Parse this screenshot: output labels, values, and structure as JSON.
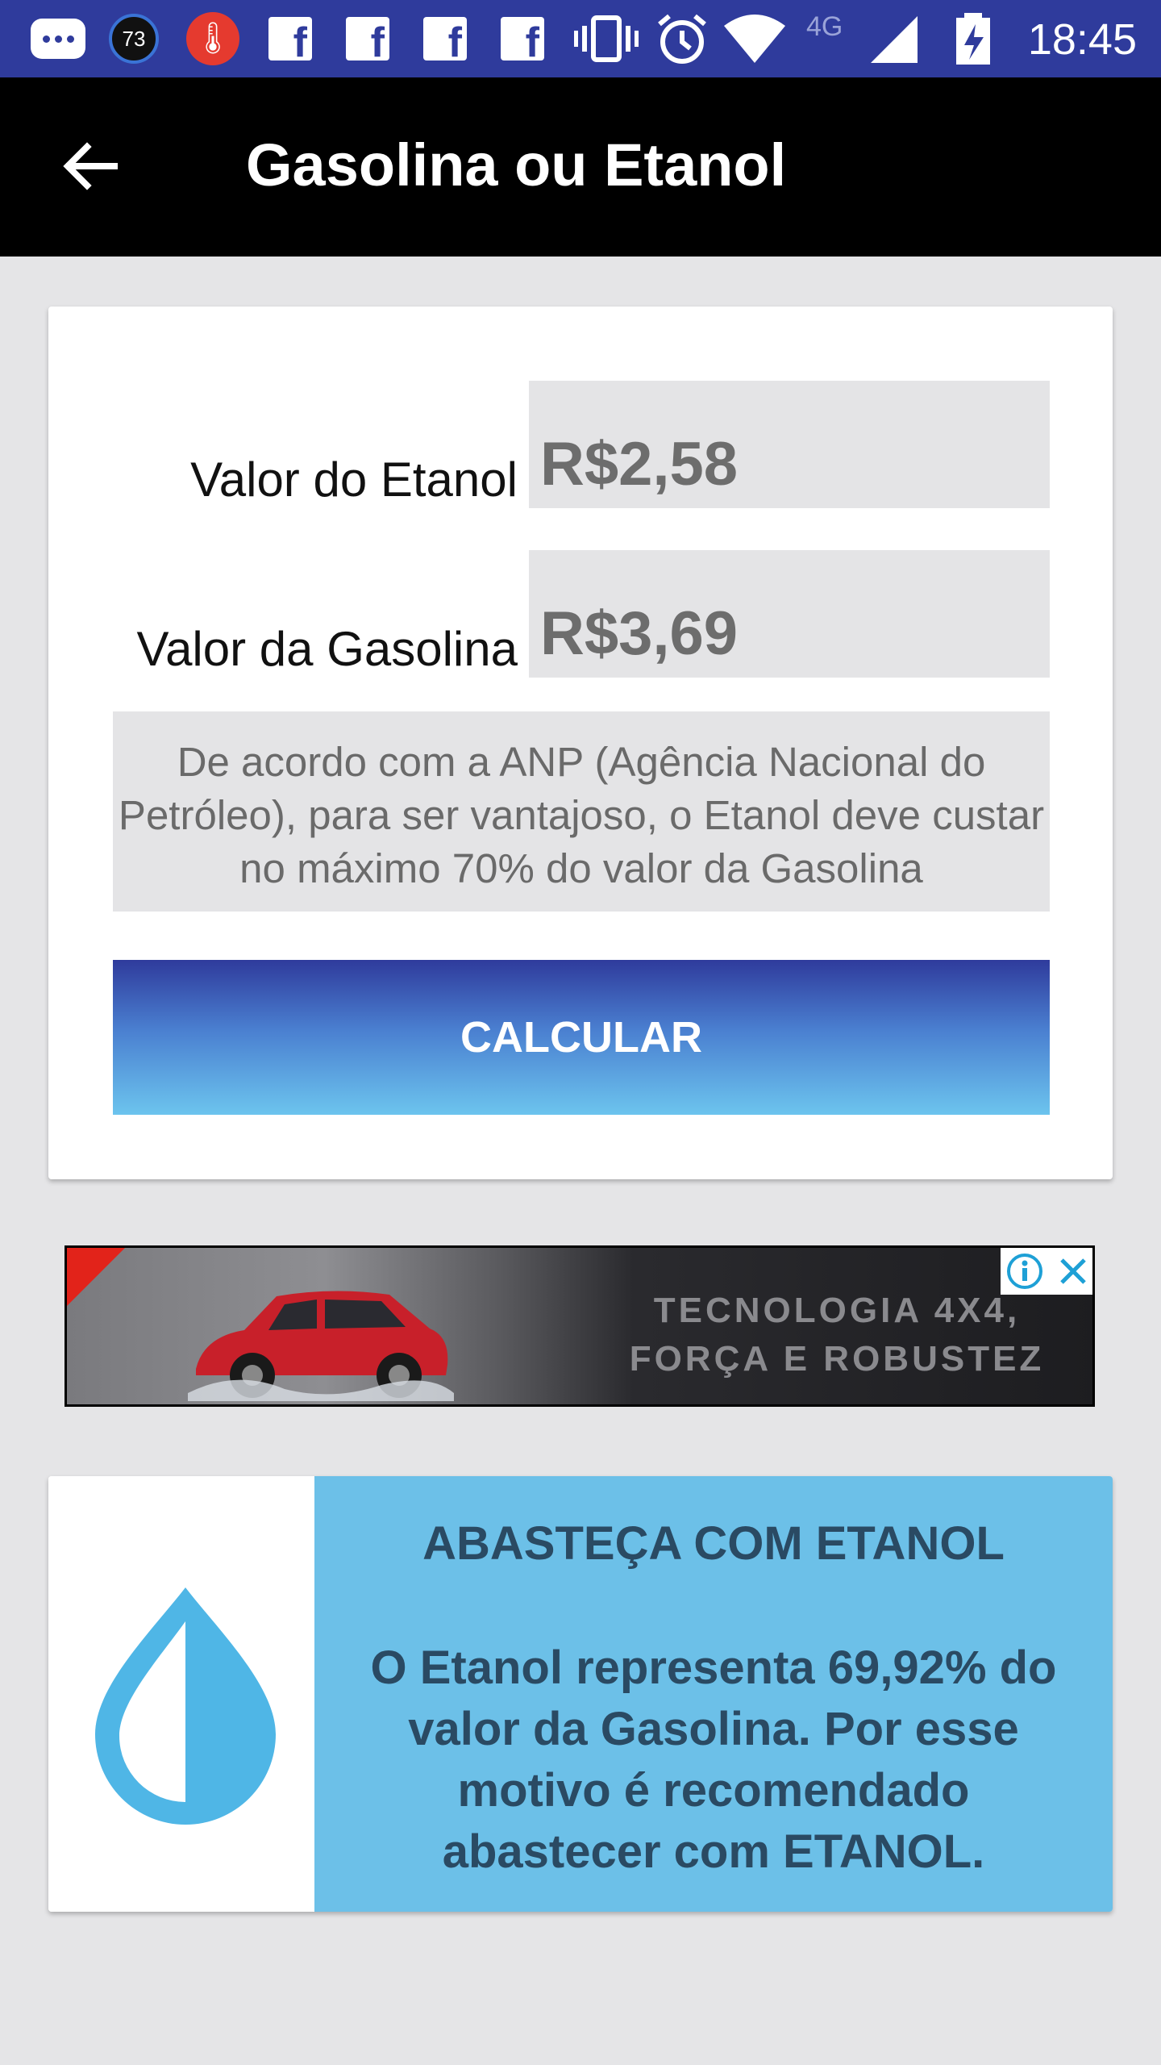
{
  "status_bar": {
    "notification_count": "73",
    "network": "4G",
    "time": "18:45"
  },
  "app_bar": {
    "title": "Gasolina ou Etanol",
    "back_icon": "arrow-left-icon"
  },
  "form": {
    "etanol_label": "Valor do Etanol",
    "etanol_value": "R$2,58",
    "gasolina_label": "Valor da Gasolina",
    "gasolina_value": "R$3,69",
    "info_text": "De acordo com a ANP (Agência Nacional do Petróleo), para ser vantajoso, o Etanol deve custar no máximo 70% do valor da Gasolina",
    "calculate_button": "CALCULAR",
    "button_gradient": [
      "#2f3b9c",
      "#6cc4ee"
    ]
  },
  "ad": {
    "text_line1": "TECNOLOGIA 4X4,",
    "text_line2": "FORÇA E ROBUSTEZ",
    "info_icon": "info-icon",
    "close_icon": "close-icon"
  },
  "result": {
    "icon": "drop-icon",
    "title": "ABASTEÇA COM ETANOL",
    "message": "O Etanol representa 69,92% do valor da Gasolina. Por esse motivo é recomendado abastecer com ETANOL.",
    "background_color": "#6cc0e8",
    "text_color": "#2a4a63"
  },
  "colors": {
    "status_bar": "#2f3b9c",
    "app_bar": "#000000",
    "page_background": "#e5e5e7"
  }
}
